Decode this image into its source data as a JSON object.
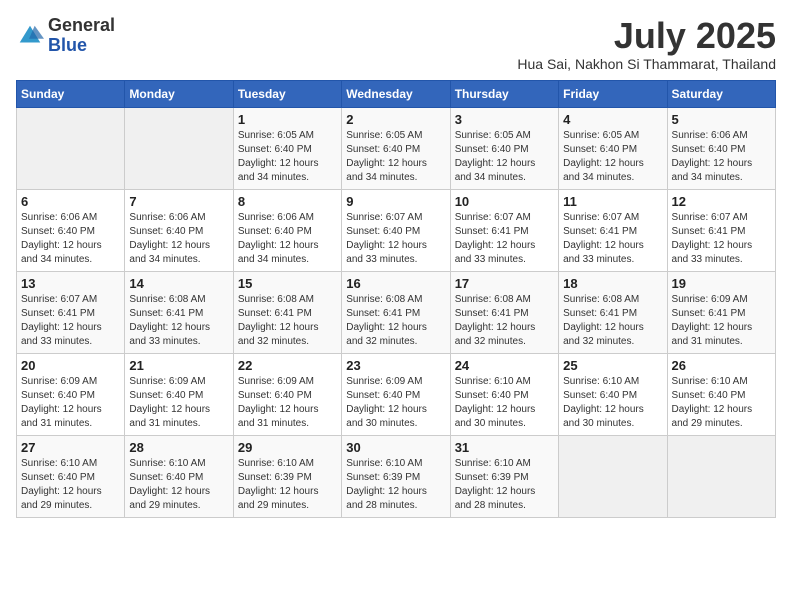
{
  "logo": {
    "general": "General",
    "blue": "Blue"
  },
  "header": {
    "month_year": "July 2025",
    "location": "Hua Sai, Nakhon Si Thammarat, Thailand"
  },
  "weekdays": [
    "Sunday",
    "Monday",
    "Tuesday",
    "Wednesday",
    "Thursday",
    "Friday",
    "Saturday"
  ],
  "weeks": [
    [
      {
        "day": "",
        "empty": true
      },
      {
        "day": "",
        "empty": true
      },
      {
        "day": "1",
        "sunrise": "Sunrise: 6:05 AM",
        "sunset": "Sunset: 6:40 PM",
        "daylight": "Daylight: 12 hours and 34 minutes."
      },
      {
        "day": "2",
        "sunrise": "Sunrise: 6:05 AM",
        "sunset": "Sunset: 6:40 PM",
        "daylight": "Daylight: 12 hours and 34 minutes."
      },
      {
        "day": "3",
        "sunrise": "Sunrise: 6:05 AM",
        "sunset": "Sunset: 6:40 PM",
        "daylight": "Daylight: 12 hours and 34 minutes."
      },
      {
        "day": "4",
        "sunrise": "Sunrise: 6:05 AM",
        "sunset": "Sunset: 6:40 PM",
        "daylight": "Daylight: 12 hours and 34 minutes."
      },
      {
        "day": "5",
        "sunrise": "Sunrise: 6:06 AM",
        "sunset": "Sunset: 6:40 PM",
        "daylight": "Daylight: 12 hours and 34 minutes."
      }
    ],
    [
      {
        "day": "6",
        "sunrise": "Sunrise: 6:06 AM",
        "sunset": "Sunset: 6:40 PM",
        "daylight": "Daylight: 12 hours and 34 minutes."
      },
      {
        "day": "7",
        "sunrise": "Sunrise: 6:06 AM",
        "sunset": "Sunset: 6:40 PM",
        "daylight": "Daylight: 12 hours and 34 minutes."
      },
      {
        "day": "8",
        "sunrise": "Sunrise: 6:06 AM",
        "sunset": "Sunset: 6:40 PM",
        "daylight": "Daylight: 12 hours and 34 minutes."
      },
      {
        "day": "9",
        "sunrise": "Sunrise: 6:07 AM",
        "sunset": "Sunset: 6:40 PM",
        "daylight": "Daylight: 12 hours and 33 minutes."
      },
      {
        "day": "10",
        "sunrise": "Sunrise: 6:07 AM",
        "sunset": "Sunset: 6:41 PM",
        "daylight": "Daylight: 12 hours and 33 minutes."
      },
      {
        "day": "11",
        "sunrise": "Sunrise: 6:07 AM",
        "sunset": "Sunset: 6:41 PM",
        "daylight": "Daylight: 12 hours and 33 minutes."
      },
      {
        "day": "12",
        "sunrise": "Sunrise: 6:07 AM",
        "sunset": "Sunset: 6:41 PM",
        "daylight": "Daylight: 12 hours and 33 minutes."
      }
    ],
    [
      {
        "day": "13",
        "sunrise": "Sunrise: 6:07 AM",
        "sunset": "Sunset: 6:41 PM",
        "daylight": "Daylight: 12 hours and 33 minutes."
      },
      {
        "day": "14",
        "sunrise": "Sunrise: 6:08 AM",
        "sunset": "Sunset: 6:41 PM",
        "daylight": "Daylight: 12 hours and 33 minutes."
      },
      {
        "day": "15",
        "sunrise": "Sunrise: 6:08 AM",
        "sunset": "Sunset: 6:41 PM",
        "daylight": "Daylight: 12 hours and 32 minutes."
      },
      {
        "day": "16",
        "sunrise": "Sunrise: 6:08 AM",
        "sunset": "Sunset: 6:41 PM",
        "daylight": "Daylight: 12 hours and 32 minutes."
      },
      {
        "day": "17",
        "sunrise": "Sunrise: 6:08 AM",
        "sunset": "Sunset: 6:41 PM",
        "daylight": "Daylight: 12 hours and 32 minutes."
      },
      {
        "day": "18",
        "sunrise": "Sunrise: 6:08 AM",
        "sunset": "Sunset: 6:41 PM",
        "daylight": "Daylight: 12 hours and 32 minutes."
      },
      {
        "day": "19",
        "sunrise": "Sunrise: 6:09 AM",
        "sunset": "Sunset: 6:41 PM",
        "daylight": "Daylight: 12 hours and 31 minutes."
      }
    ],
    [
      {
        "day": "20",
        "sunrise": "Sunrise: 6:09 AM",
        "sunset": "Sunset: 6:40 PM",
        "daylight": "Daylight: 12 hours and 31 minutes."
      },
      {
        "day": "21",
        "sunrise": "Sunrise: 6:09 AM",
        "sunset": "Sunset: 6:40 PM",
        "daylight": "Daylight: 12 hours and 31 minutes."
      },
      {
        "day": "22",
        "sunrise": "Sunrise: 6:09 AM",
        "sunset": "Sunset: 6:40 PM",
        "daylight": "Daylight: 12 hours and 31 minutes."
      },
      {
        "day": "23",
        "sunrise": "Sunrise: 6:09 AM",
        "sunset": "Sunset: 6:40 PM",
        "daylight": "Daylight: 12 hours and 30 minutes."
      },
      {
        "day": "24",
        "sunrise": "Sunrise: 6:10 AM",
        "sunset": "Sunset: 6:40 PM",
        "daylight": "Daylight: 12 hours and 30 minutes."
      },
      {
        "day": "25",
        "sunrise": "Sunrise: 6:10 AM",
        "sunset": "Sunset: 6:40 PM",
        "daylight": "Daylight: 12 hours and 30 minutes."
      },
      {
        "day": "26",
        "sunrise": "Sunrise: 6:10 AM",
        "sunset": "Sunset: 6:40 PM",
        "daylight": "Daylight: 12 hours and 29 minutes."
      }
    ],
    [
      {
        "day": "27",
        "sunrise": "Sunrise: 6:10 AM",
        "sunset": "Sunset: 6:40 PM",
        "daylight": "Daylight: 12 hours and 29 minutes."
      },
      {
        "day": "28",
        "sunrise": "Sunrise: 6:10 AM",
        "sunset": "Sunset: 6:40 PM",
        "daylight": "Daylight: 12 hours and 29 minutes."
      },
      {
        "day": "29",
        "sunrise": "Sunrise: 6:10 AM",
        "sunset": "Sunset: 6:39 PM",
        "daylight": "Daylight: 12 hours and 29 minutes."
      },
      {
        "day": "30",
        "sunrise": "Sunrise: 6:10 AM",
        "sunset": "Sunset: 6:39 PM",
        "daylight": "Daylight: 12 hours and 28 minutes."
      },
      {
        "day": "31",
        "sunrise": "Sunrise: 6:10 AM",
        "sunset": "Sunset: 6:39 PM",
        "daylight": "Daylight: 12 hours and 28 minutes."
      },
      {
        "day": "",
        "empty": true
      },
      {
        "day": "",
        "empty": true
      }
    ]
  ]
}
